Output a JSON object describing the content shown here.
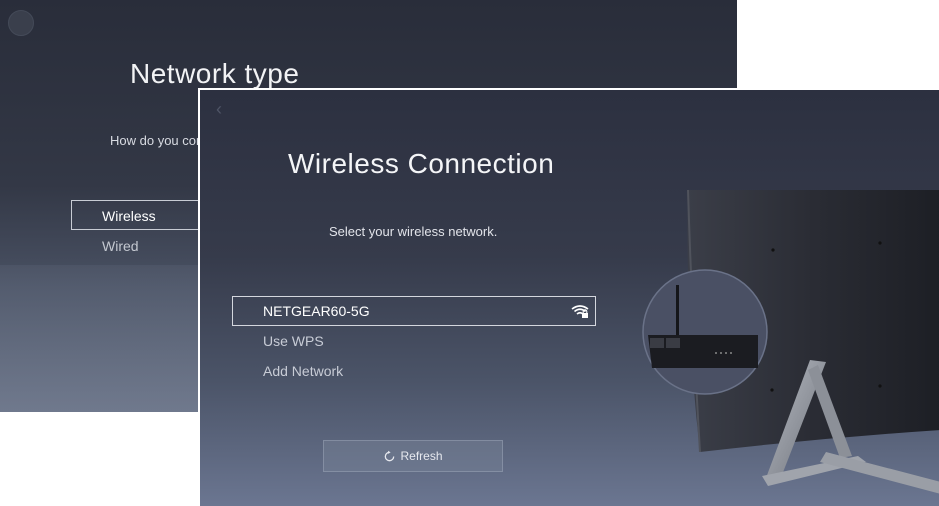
{
  "back_screen": {
    "title": "Network type",
    "subtitle": "How do you con",
    "options": [
      {
        "label": "Wireless",
        "selected": true
      },
      {
        "label": "Wired",
        "selected": false
      }
    ]
  },
  "front_screen": {
    "title": "Wireless Connection",
    "subtitle": "Select your wireless network.",
    "networks": [
      {
        "label": "NETGEAR60-5G",
        "selected": true,
        "icon": "wifi-lock-icon"
      },
      {
        "label": "Use WPS",
        "selected": false
      },
      {
        "label": "Add Network",
        "selected": false
      }
    ],
    "refresh_label": "Refresh"
  },
  "colors": {
    "background_dark": "#2c3040",
    "text_primary": "#f4f5f7",
    "focus_border": "#d4d7de"
  }
}
